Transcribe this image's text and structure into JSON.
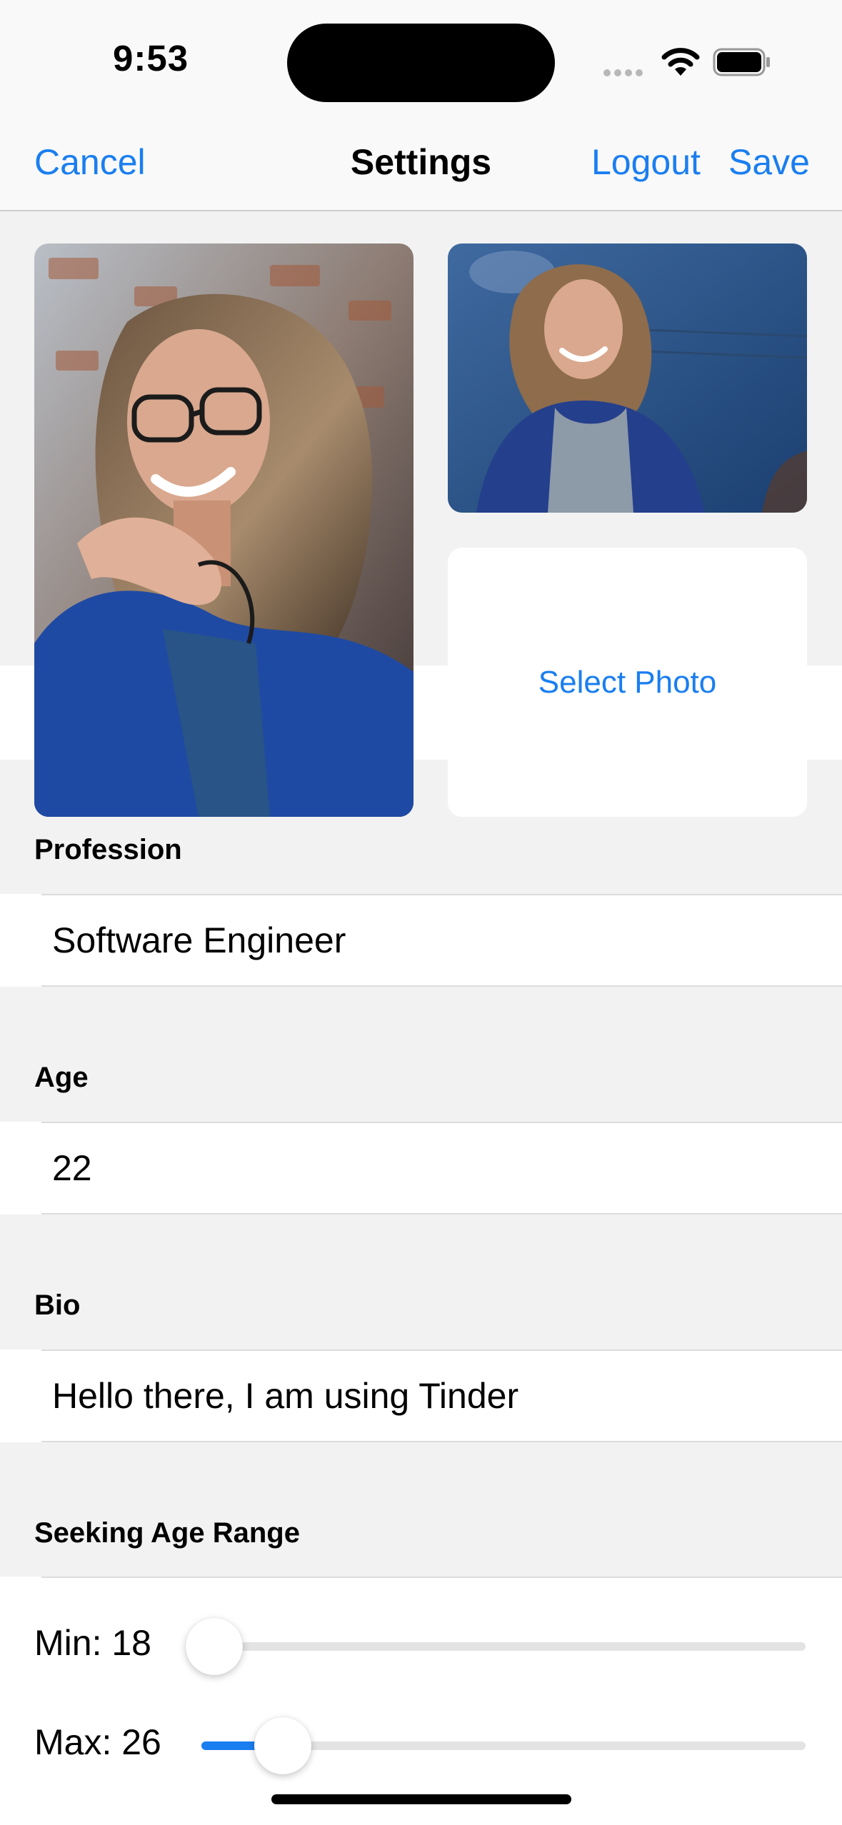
{
  "status_bar": {
    "time": "9:53"
  },
  "nav": {
    "cancel": "Cancel",
    "title": "Settings",
    "logout": "Logout",
    "save": "Save"
  },
  "photos": {
    "select_label": "Select Photo"
  },
  "form": {
    "profession": {
      "label": "Profession",
      "value": "Software Engineer"
    },
    "age": {
      "label": "Age",
      "value": "22"
    },
    "bio": {
      "label": "Bio",
      "value": "Hello there, I am using Tinder"
    },
    "age_range": {
      "label": "Seeking Age Range",
      "min_label": "Min: 18",
      "max_label": "Max: 26",
      "min_fraction": 0.0,
      "max_fraction": 0.12
    }
  },
  "colors": {
    "accent": "#1a7ef0",
    "background": "#f2f2f2"
  }
}
